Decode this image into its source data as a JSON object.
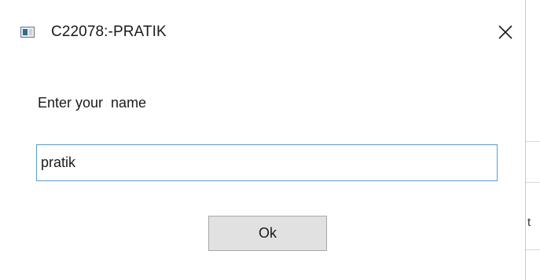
{
  "window": {
    "title": "C22078:-PRATIK",
    "icon": "application-window-icon",
    "close_icon": "close-icon"
  },
  "form": {
    "prompt": "Enter your  name",
    "name_value": "pratik"
  },
  "buttons": {
    "ok_label": "Ok"
  },
  "background_window": {
    "partial_text": "t"
  },
  "colors": {
    "input_border": "#5a9bd5",
    "button_bg": "#e1e1e1",
    "button_border": "#a8a8a8"
  }
}
